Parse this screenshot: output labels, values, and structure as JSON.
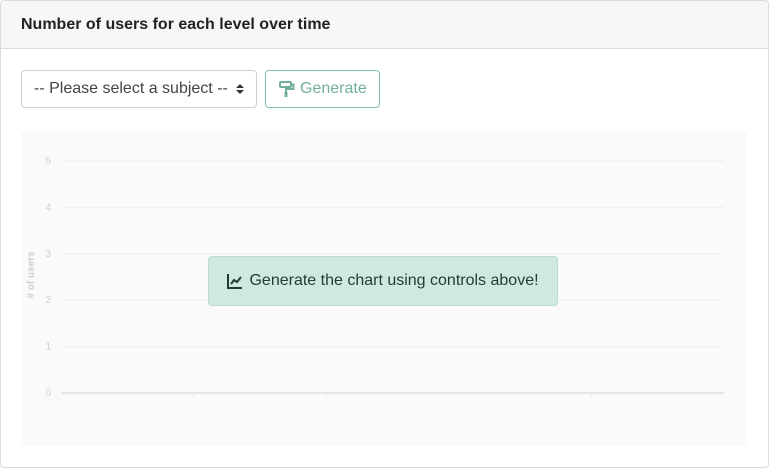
{
  "panel": {
    "title": "Number of users for each level over time"
  },
  "controls": {
    "subject_select_value": "-- Please select a subject --",
    "generate_label": "Generate"
  },
  "chart_data": {
    "type": "line",
    "ylabel": "# of users",
    "xlabel": "",
    "y_ticks": [
      "0",
      "1",
      "2",
      "3",
      "4",
      "5"
    ],
    "ylim": [
      0,
      5
    ],
    "series": [],
    "grid": true
  },
  "overlay": {
    "message": "Generate the chart using controls above!",
    "icon": "line-chart-icon"
  },
  "colors": {
    "accent": "#73b09c",
    "overlay_bg": "#d1e7e1"
  }
}
